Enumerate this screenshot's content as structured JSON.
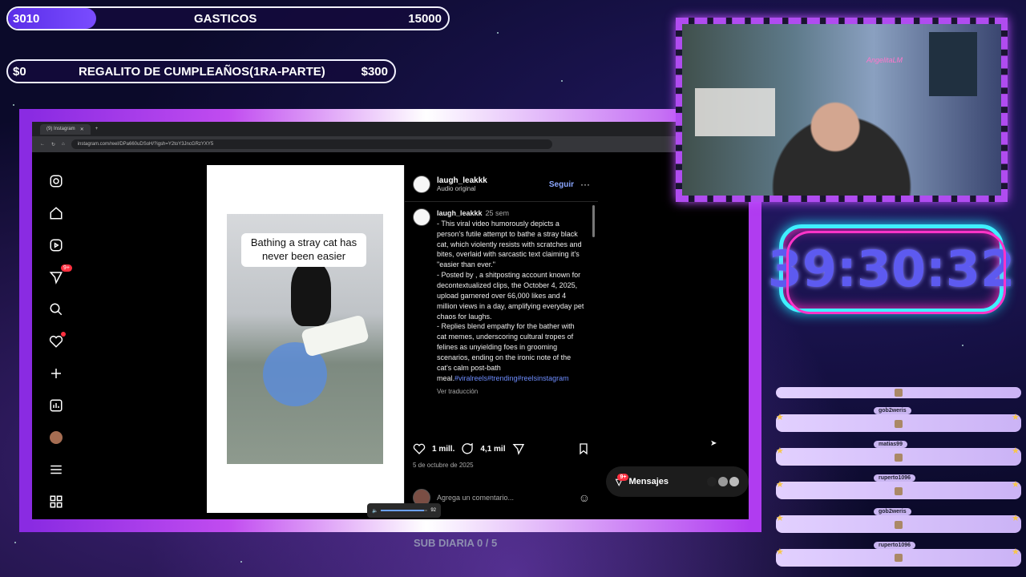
{
  "goals": {
    "g1": {
      "current": "3010",
      "title": "GASTICOS",
      "target": "15000",
      "progress": 0.2
    },
    "g2": {
      "current": "$0",
      "title": "REGALITO DE CUMPLEAÑOS(1RA-PARTE)",
      "target": "$300",
      "progress": 0
    }
  },
  "browser": {
    "tab_title": "(9) Instagram",
    "url": "instagram.com/reel/DPa660uDSoH/?igsh=Y2toY3JncGRzYXY5"
  },
  "sidebar": {
    "icons": [
      "instagram-icon",
      "home-icon",
      "reels-icon",
      "direct-icon",
      "search-icon",
      "heart-icon",
      "add-icon",
      "dashboard-icon",
      "avatar",
      "menu-icon",
      "apps-icon"
    ],
    "direct_badge": "9+"
  },
  "reel": {
    "overlay_caption": "Bathing a stray cat has never been easier"
  },
  "post": {
    "username": "laugh_leakkk",
    "audio": "Audio original",
    "follow": "Seguir",
    "more": "···",
    "comment_user": "laugh_leakkk",
    "comment_time": "25 sem",
    "comment_p1": "- This viral video humorously depicts a person's futile attempt to bathe a stray black cat, which violently resists with scratches and bites, overlaid with sarcastic text claiming it's \"easier than ever.\"",
    "comment_p2": "- Posted by , a shitposting account known for decontextualized clips, the October 4, 2025, upload garnered over 66,000 likes and 4 million views in a day, amplifying everyday pet chaos for laughs.",
    "comment_p3": "- Replies blend empathy for the bather with cat memes, underscoring cultural tropes of felines as unyielding foes in grooming scenarios, ending on the ironic note of the cat's calm post-bath meal.",
    "hashtags": "#viralreels#trending#reelsinstagram",
    "translate": "Ver traducción",
    "likes": "1 mill.",
    "comments": "4,1 mil",
    "date": "5 de octubre de 2025",
    "add_comment_placeholder": "Agrega un comentario..."
  },
  "volume": {
    "value": "92",
    "level": 0.92
  },
  "messages": {
    "label": "Mensajes",
    "badge": "9+"
  },
  "timer": {
    "value": "39:30:32"
  },
  "webcam": {
    "label": "AngelitaLM"
  },
  "chat": {
    "names": [
      "gob2weris",
      "matias99",
      "ruperto1096",
      "gob2weris",
      "ruperto1096"
    ]
  },
  "sub_diaria": "SUB DIARIA 0 / 5"
}
